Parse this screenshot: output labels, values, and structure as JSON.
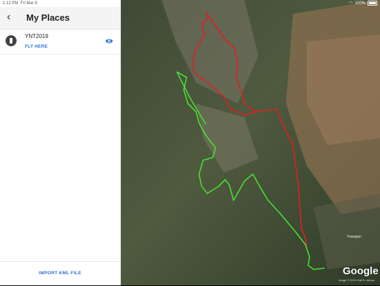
{
  "status_bar": {
    "time": "1:12 PM",
    "date": "Fri Mar 8",
    "battery": "100%"
  },
  "header": {
    "title": "My Places"
  },
  "places": [
    {
      "name": "YNT2019",
      "action": "FLY HERE"
    }
  ],
  "footer": {
    "import_label": "IMPORT KML FILE"
  },
  "map": {
    "logo": "Google",
    "attribution": "Image © 2019 CNES / Airbus",
    "town_label": "Ywangan"
  },
  "colors": {
    "accent": "#2a6fd6",
    "track_red": "#e02020",
    "track_green": "#49e034"
  }
}
